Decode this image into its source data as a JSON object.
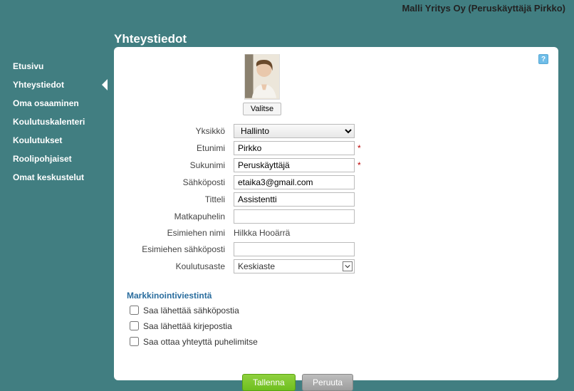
{
  "topbar": {
    "company_user": "Malli Yritys Oy (Peruskäyttäjä Pirkko)"
  },
  "page_title": "Yhteystiedot",
  "sidebar": {
    "items": [
      {
        "label": "Etusivu",
        "active": false
      },
      {
        "label": "Yhteystiedot",
        "active": true
      },
      {
        "label": "Oma osaaminen",
        "active": false
      },
      {
        "label": "Koulutuskalenteri",
        "active": false
      },
      {
        "label": "Koulutukset",
        "active": false
      },
      {
        "label": "Roolipohjaiset",
        "active": false
      },
      {
        "label": "Omat keskustelut",
        "active": false
      }
    ]
  },
  "help_icon": "?",
  "photo": {
    "choose_label": "Valitse"
  },
  "form": {
    "yksikko": {
      "label": "Yksikkö",
      "value": "Hallinto"
    },
    "etunimi": {
      "label": "Etunimi",
      "value": "Pirkko",
      "required": true
    },
    "sukunimi": {
      "label": "Sukunimi",
      "value": "Peruskäyttäjä",
      "required": true
    },
    "sahkoposti": {
      "label": "Sähköposti",
      "value": "etaika3@gmail.com"
    },
    "titteli": {
      "label": "Titteli",
      "value": "Assistentti"
    },
    "matkapuhelin": {
      "label": "Matkapuhelin",
      "value": ""
    },
    "esimies_nimi": {
      "label": "Esimiehen nimi",
      "value": "Hilkka Hooärrä"
    },
    "esimies_email": {
      "label": "Esimiehen sähköposti",
      "value": ""
    },
    "koulutusaste": {
      "label": "Koulutusaste",
      "value": "Keskiaste"
    }
  },
  "marketing": {
    "title": "Markkinointiviestintä",
    "opts": [
      {
        "label": "Saa lähettää sähköpostia"
      },
      {
        "label": "Saa lähettää kirjepostia"
      },
      {
        "label": "Saa ottaa yhteyttä puhelimitse"
      }
    ]
  },
  "actions": {
    "save": "Tallenna",
    "cancel": "Peruuta"
  }
}
